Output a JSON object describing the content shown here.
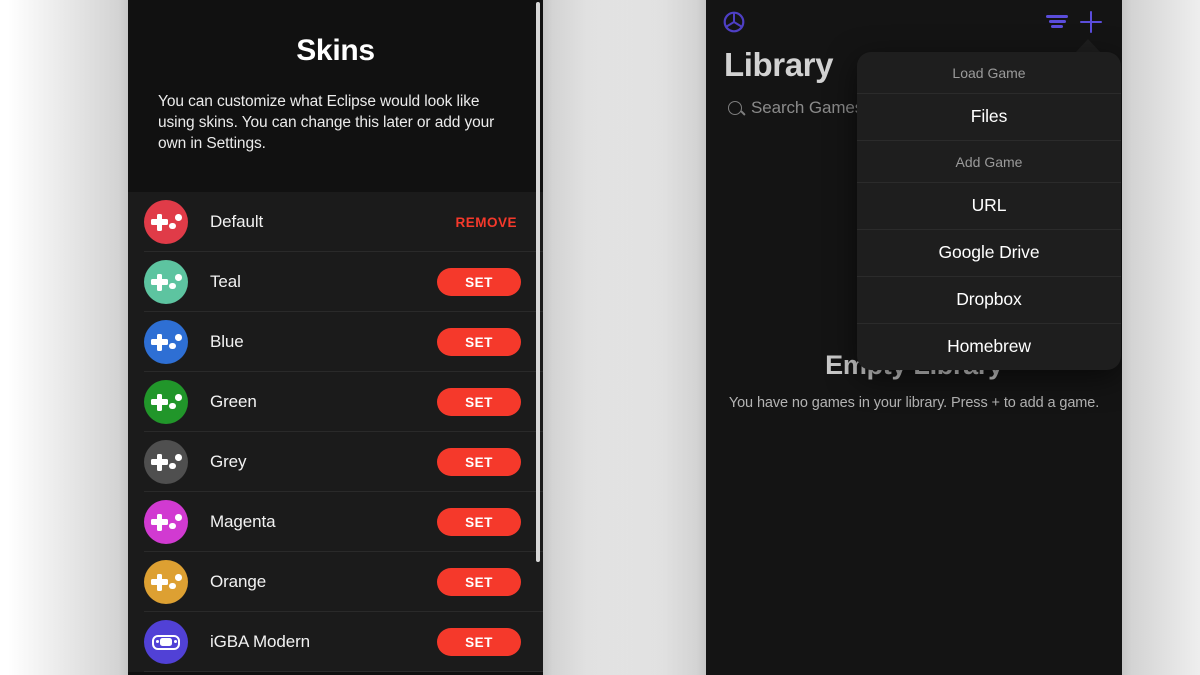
{
  "skins_screen": {
    "title": "Skins",
    "description": "You can customize what Eclipse would look like using skins. You can change this later or add your own in Settings.",
    "remove_label": "REMOVE",
    "set_label": "SET",
    "items": [
      {
        "name": "Default",
        "color": "#e03b48",
        "glyph": "gamepad-icon",
        "action": "REMOVE"
      },
      {
        "name": "Teal",
        "color": "#5dc4a0",
        "glyph": "gamepad-icon",
        "action": "SET"
      },
      {
        "name": "Blue",
        "color": "#2e6fd4",
        "glyph": "gamepad-icon",
        "action": "SET"
      },
      {
        "name": "Green",
        "color": "#21962a",
        "glyph": "gamepad-icon",
        "action": "SET"
      },
      {
        "name": "Grey",
        "color": "#4f4f4f",
        "glyph": "gamepad-icon",
        "action": "SET"
      },
      {
        "name": "Magenta",
        "color": "#d13ad1",
        "glyph": "gamepad-icon",
        "action": "SET"
      },
      {
        "name": "Orange",
        "color": "#dda032",
        "glyph": "gamepad-icon",
        "action": "SET"
      },
      {
        "name": "iGBA Modern",
        "color": "#5141d6",
        "glyph": "handheld-icon",
        "action": "SET"
      }
    ]
  },
  "library_screen": {
    "logo": "eclipse-logo-icon",
    "filter_icon": "filter-icon",
    "add_icon": "plus-icon",
    "title": "Library",
    "search": {
      "icon": "search-icon",
      "placeholder": "Search Games",
      "value": ""
    },
    "empty": {
      "title": "Empty Library",
      "subtitle": "You have no games in your library. Press + to add a game."
    },
    "context_menu": {
      "sections": [
        {
          "header": "Load Game",
          "items": [
            "Files"
          ]
        },
        {
          "header": "Add Game",
          "items": [
            "URL",
            "Google Drive",
            "Dropbox",
            "Homebrew"
          ]
        }
      ]
    }
  },
  "colors": {
    "accent_red": "#f5392b",
    "accent_purple": "#5b4ddb",
    "phone_bg": "#101010",
    "list_bg": "#1b1b1b",
    "menu_bg": "#1e1e1e"
  }
}
